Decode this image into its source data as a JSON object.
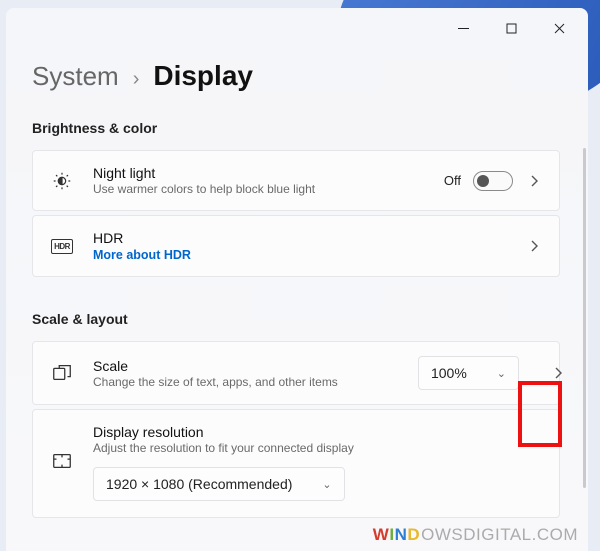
{
  "breadcrumb": {
    "parent": "System",
    "current": "Display"
  },
  "sections": {
    "brightness": {
      "title": "Brightness & color",
      "night_light": {
        "title": "Night light",
        "subtitle": "Use warmer colors to help block blue light",
        "state_label": "Off"
      },
      "hdr": {
        "title": "HDR",
        "link": "More about HDR",
        "icon_text": "HDR"
      }
    },
    "scale_layout": {
      "title": "Scale & layout",
      "scale": {
        "title": "Scale",
        "subtitle": "Change the size of text, apps, and other items",
        "value": "100%"
      },
      "resolution": {
        "title": "Display resolution",
        "subtitle": "Adjust the resolution to fit your connected display",
        "value": "1920 × 1080 (Recommended)"
      }
    }
  },
  "watermark": {
    "w": "W",
    "i": "I",
    "n": "N",
    "d": "D",
    "rest": "OWSDIGITAL.COM"
  }
}
